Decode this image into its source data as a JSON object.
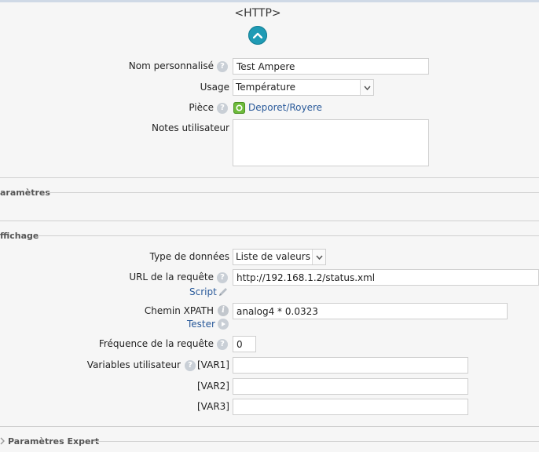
{
  "header": {
    "title": "<HTTP>"
  },
  "general": {
    "name_label": "Nom personnalisé",
    "name_value": "Test Ampere",
    "usage_label": "Usage",
    "usage_value": "Température",
    "room_label": "Pièce",
    "room_value": "Deporet/Royere",
    "notes_label": "Notes utilisateur",
    "notes_value": ""
  },
  "sections": {
    "parameters": "aramètres",
    "display": "ffichage",
    "expert": "Paramètres Expert"
  },
  "display": {
    "datatype_label": "Type de données",
    "datatype_value": "Liste de valeurs",
    "url_label": "URL de la requête",
    "url_value": "http://192.168.1.2/status.xml",
    "script_link": "Script",
    "xpath_label": "Chemin XPATH",
    "xpath_value": "analog4 * 0.0323",
    "test_link": "Tester",
    "freq_label": "Fréquence de la requête",
    "freq_value": "0",
    "vars_label": "Variables utilisateur",
    "var1_label": "[VAR1]",
    "var1_value": "",
    "var2_label": "[VAR2]",
    "var2_value": "",
    "var3_label": "[VAR3]",
    "var3_value": ""
  },
  "icons": {
    "help": "help-icon",
    "info": "info-icon",
    "edit": "pencil-icon",
    "play": "play-icon",
    "room": "room-icon",
    "collapse": "chevron-up-icon",
    "dropdown": "chevron-down-icon"
  },
  "colors": {
    "accent": "#1f9bb5",
    "link": "#2a5a9a",
    "room_icon": "#6dbb3a"
  }
}
